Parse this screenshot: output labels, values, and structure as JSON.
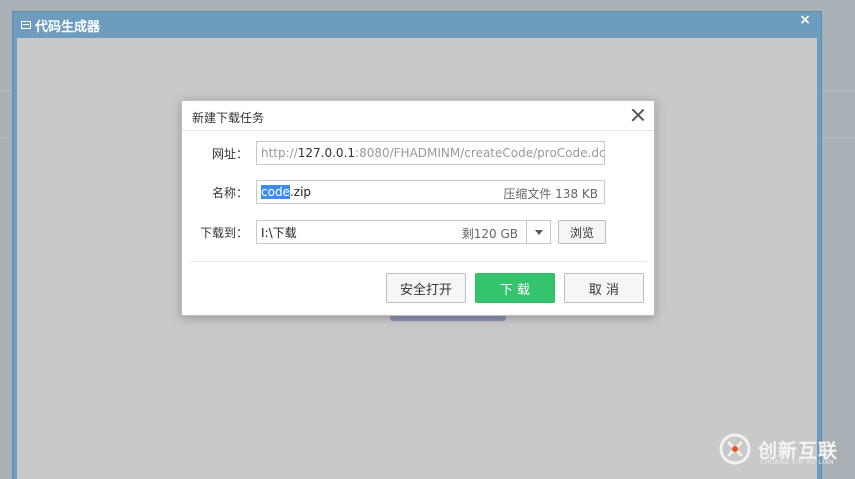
{
  "outer_window": {
    "title": "代码生成器",
    "close_glyph": "×"
  },
  "dialog": {
    "title": "新建下载任务",
    "url": {
      "label": "网址：",
      "prefix": "http://",
      "host": "127.0.0.1",
      "rest": ":8080/FHADMINM/createCode/proCode.dc"
    },
    "name": {
      "label": "名称：",
      "selected": "code",
      "rest": ".zip",
      "info": "压缩文件 138 KB"
    },
    "path": {
      "label": "下载到：",
      "value": "I:\\下载",
      "free": "剩120 GB"
    },
    "browse_label": "浏览",
    "buttons": {
      "safe_open": "安全打开",
      "download": "下 载",
      "cancel": "取 消"
    }
  },
  "watermark": {
    "text": "创新互联",
    "subtext": "CHUANG XIN HU LIAN"
  },
  "colors": {
    "window_title_bar": "#6d9cbf",
    "download_button": "#34c46c",
    "selection": "#3e8ee8"
  }
}
